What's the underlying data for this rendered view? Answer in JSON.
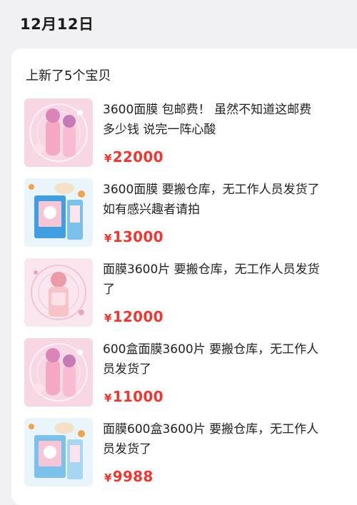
{
  "date": "12月12日",
  "card_title": "上新了5个宝贝",
  "currency_symbol": "¥",
  "items": [
    {
      "line1": "3600面膜   包邮费！  虽然不知道这邮费",
      "line2": "多少钱 说完一阵心酸",
      "price": "22000",
      "thumb_style": "pink-bottles"
    },
    {
      "line1": "3600面膜 要搬仓库，无工作人员发货了",
      "line2": "如有感兴趣者请拍",
      "price": "13000",
      "thumb_style": "blue-packs"
    },
    {
      "line1": "面膜3600片 要搬仓库，无工作人员发货",
      "line2": "了",
      "price": "12000",
      "thumb_style": "pink-tube"
    },
    {
      "line1": "600盒面膜3600片 要搬仓库，无工作人",
      "line2": "员发货了",
      "price": "11000",
      "thumb_style": "pink-bottles"
    },
    {
      "line1": "面膜600盒3600片 要搬仓库，无工作人",
      "line2": "员发货了",
      "price": "9988",
      "thumb_style": "blue-packs"
    }
  ]
}
